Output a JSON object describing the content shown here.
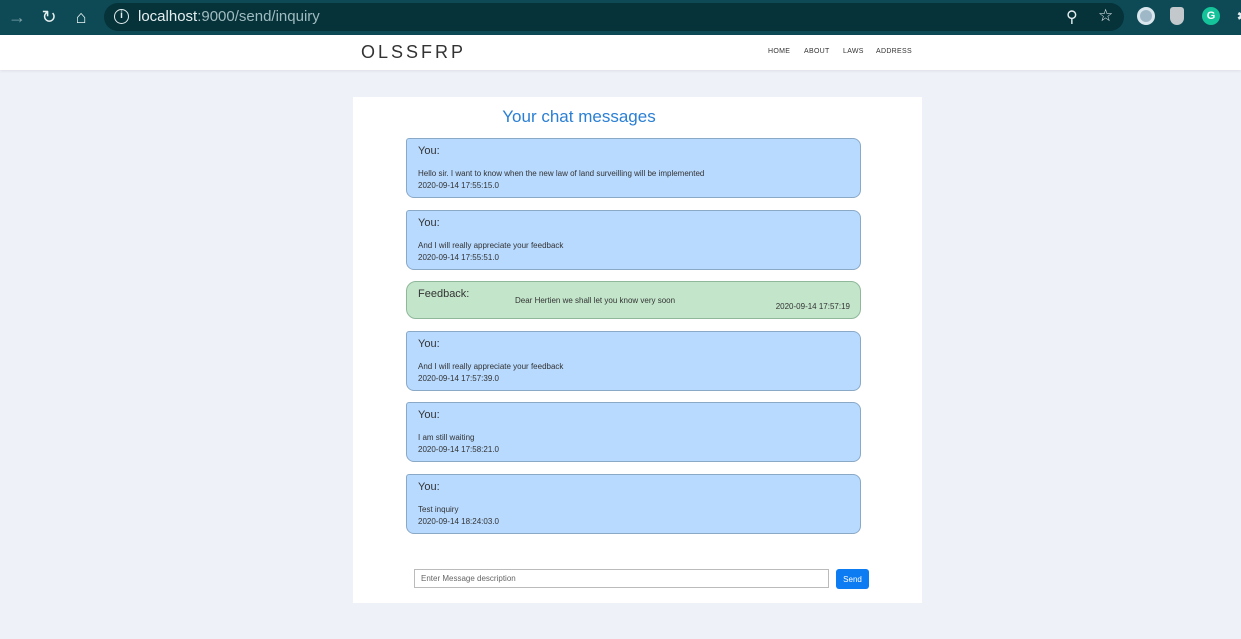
{
  "browser": {
    "url_host": "localhost",
    "url_rest": ":9000/send/inquiry",
    "back_glyph": "→",
    "reload_glyph": "↻",
    "home_glyph": "⌂",
    "info_glyph": "i",
    "zoom_glyph": "⚲",
    "star_glyph": "☆",
    "ext3_letter": "G",
    "ext4_glyph": "✱"
  },
  "header": {
    "brand": "OLSSFRP",
    "nav": [
      "HOME",
      "ABOUT",
      "LAWS",
      "ADDRESS"
    ]
  },
  "chat": {
    "title": "Your chat messages",
    "messages": [
      {
        "sender": "You:",
        "text": "Hello sir. I want to know when the new law of land surveilling will be implemented",
        "time": "2020-09-14 17:55:15.0"
      },
      {
        "sender": "You:",
        "text": "And I will really appreciate your feedback",
        "time": "2020-09-14 17:55:51.0"
      },
      {
        "sender": "Feedback:",
        "text": "Dear Hertien we shall let you know very soon",
        "time": "2020-09-14 17:57:19"
      },
      {
        "sender": "You:",
        "text": "And I will really appreciate your feedback",
        "time": "2020-09-14 17:57:39.0"
      },
      {
        "sender": "You:",
        "text": "I am still waiting",
        "time": "2020-09-14 17:58:21.0"
      },
      {
        "sender": "You:",
        "text": "Test inquiry",
        "time": "2020-09-14 18:24:03.0"
      }
    ],
    "input_placeholder": "Enter Message description",
    "send_label": "Send"
  },
  "colors": {
    "user_bubble": "#b8daff",
    "feedback_bubble": "#c3e6cb",
    "title": "#2a7fd4",
    "send_button": "#0d7bf2",
    "chrome": "#0d4a55"
  }
}
